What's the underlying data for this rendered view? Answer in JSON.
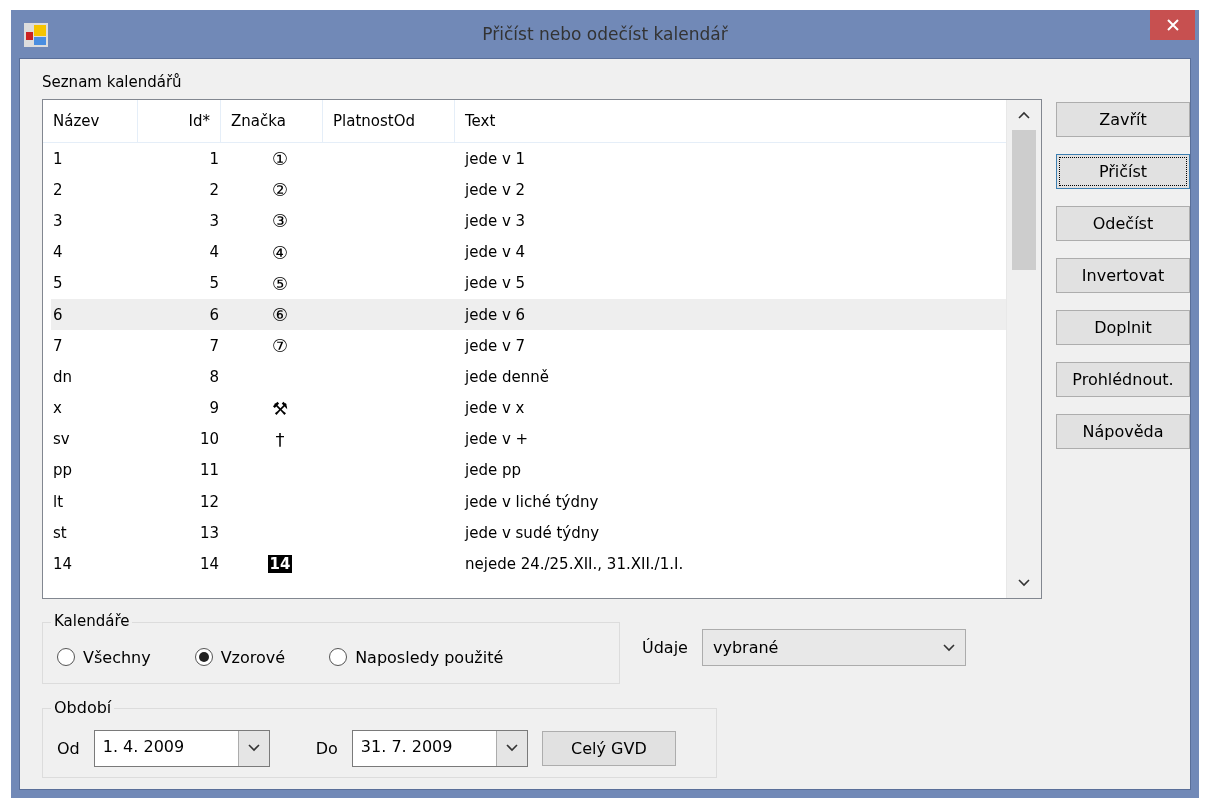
{
  "window": {
    "title": "Přičíst nebo odečíst kalendář"
  },
  "list_label": "Seznam kalendářů",
  "table": {
    "columns": [
      "Název",
      "Id*",
      "Značka",
      "PlatnostOd",
      "Text"
    ],
    "rows": [
      {
        "name": "1",
        "id": "1",
        "mark": "①",
        "kind": "glyph",
        "text": "jede v 1",
        "selected": false
      },
      {
        "name": "2",
        "id": "2",
        "mark": "②",
        "kind": "glyph",
        "text": "jede v 2",
        "selected": false
      },
      {
        "name": "3",
        "id": "3",
        "mark": "③",
        "kind": "glyph",
        "text": "jede v 3",
        "selected": false
      },
      {
        "name": "4",
        "id": "4",
        "mark": "④",
        "kind": "glyph",
        "text": "jede v 4",
        "selected": false
      },
      {
        "name": "5",
        "id": "5",
        "mark": "⑤",
        "kind": "glyph",
        "text": "jede v 5",
        "selected": false
      },
      {
        "name": "6",
        "id": "6",
        "mark": "⑥",
        "kind": "glyph",
        "text": "jede v 6",
        "selected": true
      },
      {
        "name": "7",
        "id": "7",
        "mark": "⑦",
        "kind": "glyph",
        "text": "jede v 7",
        "selected": false
      },
      {
        "name": "dn",
        "id": "8",
        "text": "jede denně",
        "selected": false
      },
      {
        "name": "x",
        "id": "9",
        "mark": "⚒",
        "kind": "glyph",
        "text": "jede v x",
        "selected": false
      },
      {
        "name": "sv",
        "id": "10",
        "mark": "†",
        "kind": "glyph",
        "text": "jede v +",
        "selected": false
      },
      {
        "name": "pp",
        "id": "11",
        "text": "jede pp",
        "selected": false
      },
      {
        "name": "lt",
        "id": "12",
        "text": "jede v liché týdny",
        "selected": false
      },
      {
        "name": "st",
        "id": "13",
        "text": "jede v sudé týdny",
        "selected": false
      },
      {
        "name": "14",
        "id": "14",
        "mark": "14",
        "kind": "inverse",
        "text": "nejede 24./25.XII., 31.XII./1.I.",
        "selected": false
      }
    ]
  },
  "buttons": [
    {
      "label": "Zavřít",
      "focused": false
    },
    {
      "label": "Přičíst",
      "focused": true
    },
    {
      "label": "Odečíst",
      "focused": false
    },
    {
      "label": "Invertovat",
      "focused": false
    },
    {
      "label": "Doplnit",
      "focused": false
    },
    {
      "label": "Prohlédnout.",
      "focused": false
    },
    {
      "label": "Nápověda",
      "focused": false
    }
  ],
  "calendars_group": {
    "title": "Kalendáře",
    "options": [
      {
        "label": "Všechny",
        "selected": false
      },
      {
        "label": "Vzorové",
        "selected": true
      },
      {
        "label": "Naposledy použité",
        "selected": false
      }
    ]
  },
  "data_field": {
    "label": "Údaje",
    "value": "vybrané"
  },
  "period_group": {
    "title": "Období",
    "from_label": "Od",
    "from_value": "1. 4. 2009",
    "to_label": "Do",
    "to_value": "31. 7. 2009",
    "whole_button": "Celý GVD"
  }
}
